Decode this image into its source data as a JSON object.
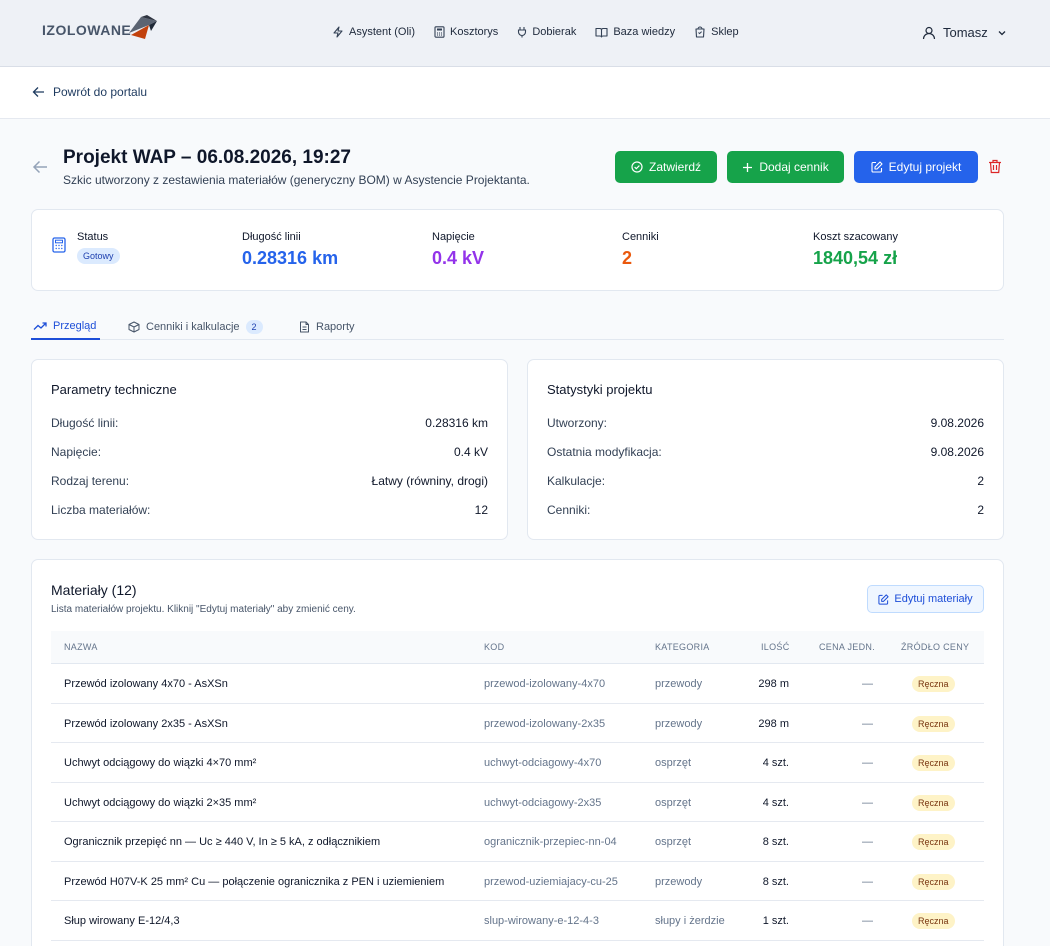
{
  "brand": {
    "name": "IZOLOWANE"
  },
  "nav": [
    {
      "label": "Asystent (Oli)",
      "icon": "bolt-icon"
    },
    {
      "label": "Kosztorys",
      "icon": "calculator-icon"
    },
    {
      "label": "Dobierak",
      "icon": "plug-icon"
    },
    {
      "label": "Baza wiedzy",
      "icon": "book-icon"
    },
    {
      "label": "Sklep",
      "icon": "shop-icon"
    }
  ],
  "user": {
    "name": "Tomasz"
  },
  "back_link": "Powrót do portalu",
  "project": {
    "title": "Projekt WAP – 06.08.2026, 19:27",
    "subtitle": "Szkic utworzony z zestawienia materiałów (generyczny BOM) w Asystencie Projektanta."
  },
  "actions": {
    "approve": "Zatwierdź",
    "add_pricelist": "Dodaj cennik",
    "edit_project": "Edytuj projekt"
  },
  "summary": {
    "status_label": "Status",
    "status_value": "Gotowy",
    "length_label": "Długość linii",
    "length_value": "0.28316 km",
    "voltage_label": "Napięcie",
    "voltage_value": "0.4 kV",
    "pricelists_label": "Cenniki",
    "pricelists_value": "2",
    "cost_label": "Koszt szacowany",
    "cost_value": "1840,54 zł"
  },
  "tabs": [
    {
      "label": "Przegląd"
    },
    {
      "label": "Cenniki i kalkulacje",
      "count": "2"
    },
    {
      "label": "Raporty"
    }
  ],
  "tech": {
    "title": "Parametry techniczne",
    "rows": [
      {
        "label": "Długość linii:",
        "value": "0.28316 km"
      },
      {
        "label": "Napięcie:",
        "value": "0.4 kV"
      },
      {
        "label": "Rodzaj terenu:",
        "value": "Łatwy (równiny, drogi)"
      },
      {
        "label": "Liczba materiałów:",
        "value": "12"
      }
    ]
  },
  "stats": {
    "title": "Statystyki projektu",
    "rows": [
      {
        "label": "Utworzony:",
        "value": "9.08.2026"
      },
      {
        "label": "Ostatnia modyfikacja:",
        "value": "9.08.2026"
      },
      {
        "label": "Kalkulacje:",
        "value": "2"
      },
      {
        "label": "Cenniki:",
        "value": "2"
      }
    ]
  },
  "materials": {
    "title": "Materiały (12)",
    "subtitle": "Lista materiałów projektu. Kliknij \"Edytuj materiały\" aby zmienić ceny.",
    "edit_label": "Edytuj materiały",
    "columns": [
      "NAZWA",
      "KOD",
      "KATEGORIA",
      "ILOŚĆ",
      "CENA JEDN.",
      "ŹRÓDŁO CENY"
    ],
    "rows": [
      {
        "name": "Przewód izolowany 4x70 - AsXSn",
        "code": "przewod-izolowany-4x70",
        "category": "przewody",
        "qty": "298 m",
        "price": "—",
        "source": "Ręczna"
      },
      {
        "name": "Przewód izolowany 2x35 - AsXSn",
        "code": "przewod-izolowany-2x35",
        "category": "przewody",
        "qty": "298 m",
        "price": "—",
        "source": "Ręczna"
      },
      {
        "name": "Uchwyt odciągowy do wiązki 4×70 mm²",
        "code": "uchwyt-odciagowy-4x70",
        "category": "osprzęt",
        "qty": "4 szt.",
        "price": "—",
        "source": "Ręczna"
      },
      {
        "name": "Uchwyt odciągowy do wiązki 2×35 mm²",
        "code": "uchwyt-odciagowy-2x35",
        "category": "osprzęt",
        "qty": "4 szt.",
        "price": "—",
        "source": "Ręczna"
      },
      {
        "name": "Ogranicznik przepięć nn — Uc ≥ 440 V, In ≥ 5 kA, z odłącznikiem",
        "code": "ogranicznik-przepiec-nn-04",
        "category": "osprzęt",
        "qty": "8 szt.",
        "price": "—",
        "source": "Ręczna"
      },
      {
        "name": "Przewód H07V-K 25 mm² Cu — połączenie ogranicznika z PEN i uziemieniem",
        "code": "przewod-uziemiajacy-cu-25",
        "category": "przewody",
        "qty": "8 szt.",
        "price": "—",
        "source": "Ręczna"
      },
      {
        "name": "Słup wirowany E-12/4,3",
        "code": "slup-wirowany-e-12-4-3",
        "category": "słupy i żerdzie",
        "qty": "1 szt.",
        "price": "—",
        "source": "Ręczna"
      }
    ]
  },
  "colors": {
    "accent_blue": "#2563eb",
    "accent_green": "#16a34a",
    "voltage_purple": "#9333ea",
    "pricelists_orange": "#ea580c",
    "danger_red": "#dc2626"
  }
}
